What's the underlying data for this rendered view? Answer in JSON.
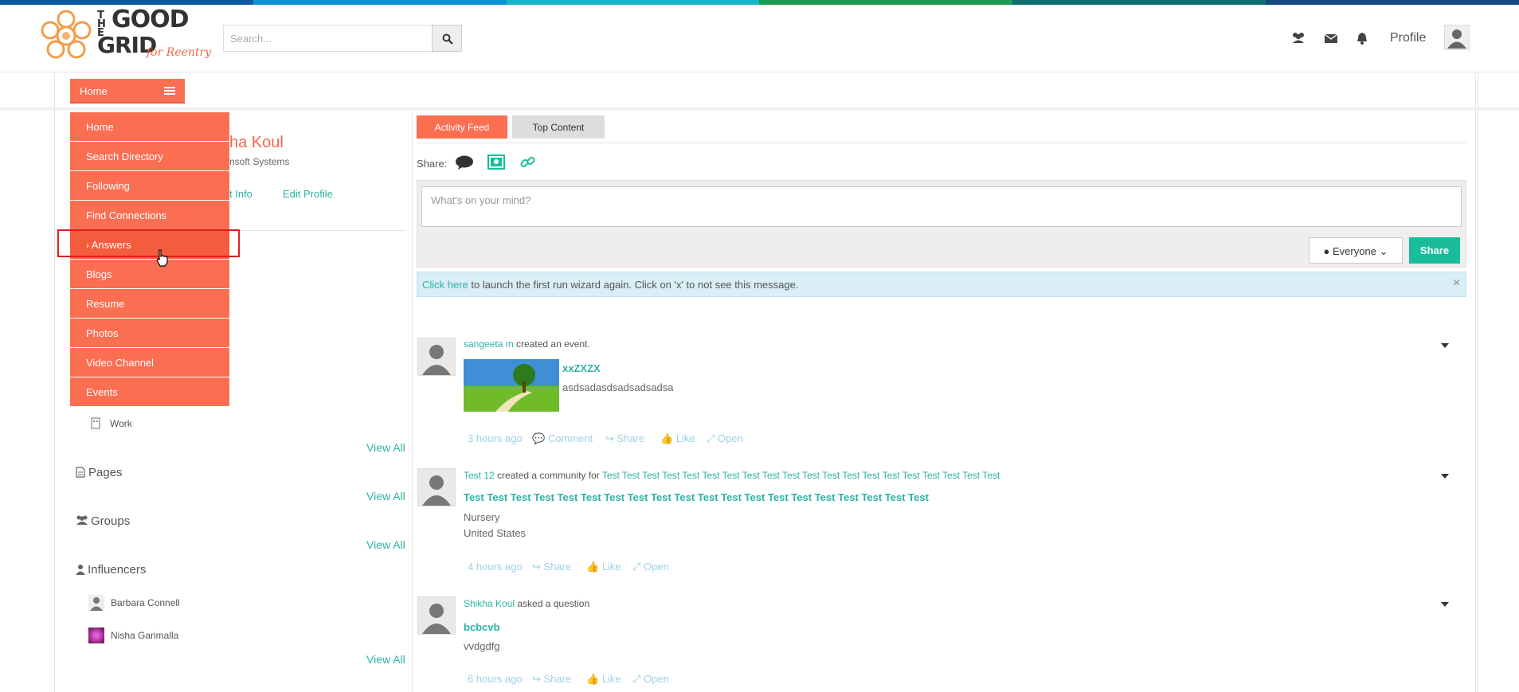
{
  "colors": {
    "accent": "#fa6e52",
    "teal": "#1abc9c",
    "link": "#2bb3a5",
    "stripe": [
      "#0c5aa6",
      "#0e8fd6",
      "#19b4c8",
      "#1a9b52",
      "#0e6d6d",
      "#16497d"
    ]
  },
  "header": {
    "logo_line1": "THE",
    "logo_line2": "GOOD",
    "logo_line3": "GRID",
    "logo_tag": "for Reentry",
    "search_placeholder": "Search...",
    "icons": [
      "users-icon",
      "envelope-icon",
      "bell-icon"
    ],
    "profile_label": "Profile"
  },
  "home_button": {
    "label": "Home"
  },
  "menu": {
    "items": [
      "Home",
      "Search Directory",
      "Following",
      "Find Connections",
      "Answers",
      "Blogs",
      "Resume",
      "Photos",
      "Video Channel",
      "Events"
    ]
  },
  "profile": {
    "name_partial": "ha Koul",
    "company_partial": "nsoft Systems",
    "contact_partial": "t Info",
    "edit_profile": "Edit Profile"
  },
  "sidebar": {
    "work_label": "Work",
    "view_all": "View All",
    "pages_title": "Pages",
    "groups_title": "Groups",
    "influencers_title": "Influencers",
    "influencers": [
      "Barbara Connell",
      "Nisha Garimalla"
    ]
  },
  "tabs": {
    "activity": "Activity Feed",
    "top": "Top Content"
  },
  "share": {
    "label": "Share:",
    "placeholder": "What's on your mind?",
    "audience": "Everyone",
    "button": "Share"
  },
  "alert": {
    "link": "Click here",
    "text": " to launch the first run wizard again. Click on 'x' to not see this message.",
    "close": "×"
  },
  "feed": {
    "post1": {
      "user": "sangeeta m",
      "action": " created an event.",
      "title": "xxZXZX",
      "desc": "asdsadasdsadsadsadsa",
      "time": "3 hours ago",
      "comment": "Comment",
      "share": "Share",
      "like": "Like",
      "open": "Open"
    },
    "post2": {
      "user": "Test 12",
      "action": " created a community for ",
      "target": "Test Test Test Test Test Test Test Test Test Test Test Test Test Test Test Test Test Test Test Test",
      "title": "Test Test Test Test Test Test Test Test Test Test Test Test Test Test Test Test Test Test Test Test",
      "line1": "Nursery",
      "line2": "United States",
      "time": "4 hours ago",
      "share": "Share",
      "like": "Like",
      "open": "Open"
    },
    "post3": {
      "user": "Shikha Koul",
      "action": " asked a question",
      "title": "bcbcvb",
      "desc": "vvdgdfg",
      "time": "6 hours ago",
      "share": "Share",
      "like": "Like",
      "open": "Open"
    }
  }
}
